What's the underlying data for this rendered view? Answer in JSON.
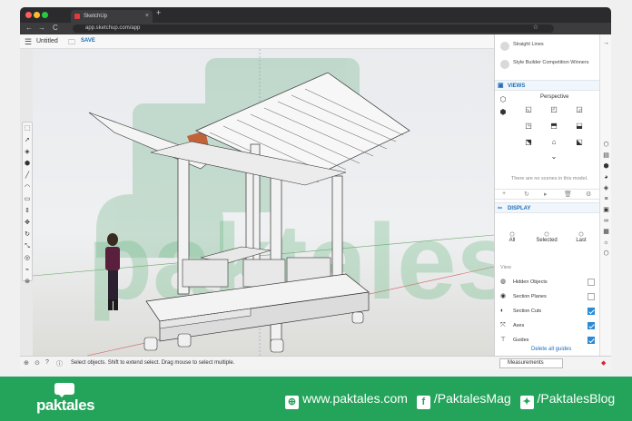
{
  "browser": {
    "tab_title": "SketchUp",
    "new_tab": "+",
    "tab_close": "×",
    "url": "app.sketchup.com/app",
    "nav_back": "←",
    "nav_forward": "→",
    "nav_reload": "C",
    "star": "☆"
  },
  "app": {
    "doc_title": "Untitled",
    "save_label": "SAVE",
    "menu_icon": "hamburger-icon",
    "folder_icon": "folder-icon"
  },
  "viewport": {
    "watermark_text": "paktales"
  },
  "panel": {
    "styles": [
      {
        "label": "Straight Lines"
      },
      {
        "label": "Style Builder Competition Winners"
      }
    ],
    "views_header": "VIEWS",
    "perspective_label": "Perspective",
    "no_scenes_text": "There are no scenes in this model.",
    "display_header": "DISPLAY",
    "display_options": [
      {
        "label": "All"
      },
      {
        "label": "Selected"
      },
      {
        "label": "Last"
      }
    ],
    "view_label": "View",
    "view_rows": [
      {
        "label": "Hidden Objects",
        "checked": false
      },
      {
        "label": "Section Planes",
        "checked": false
      },
      {
        "label": "Section Cuts",
        "checked": true
      },
      {
        "label": "Axes",
        "checked": true
      },
      {
        "label": "Guides",
        "checked": true
      }
    ],
    "delete_guides": "Delete all guides"
  },
  "status": {
    "hint": "Select objects. Shift to extend select. Drag mouse to select multiple.",
    "measurements_label": "Measurements"
  },
  "footer": {
    "logo": "paktales",
    "website": "www.paktales.com",
    "facebook": "/PaktalesMag",
    "twitter": "/PaktalesBlog",
    "accent_color": "#23a45a"
  }
}
